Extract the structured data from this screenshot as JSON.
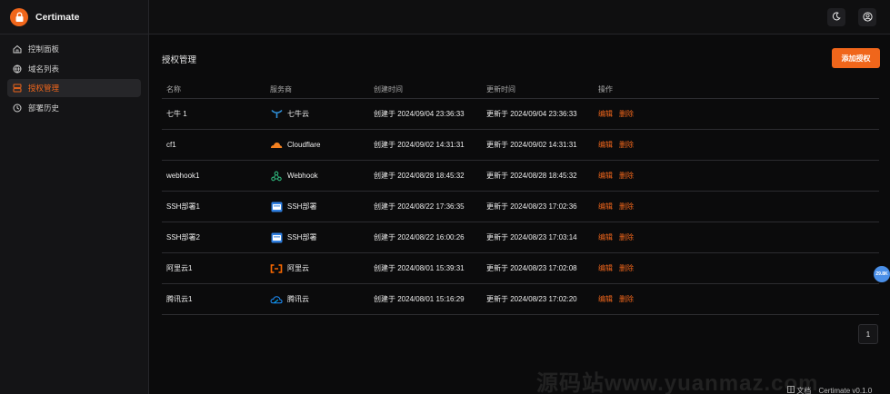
{
  "app": {
    "name": "Certimate"
  },
  "sidebar": {
    "items": [
      {
        "label": "控制面板",
        "icon": "home-icon",
        "active": false
      },
      {
        "label": "域名列表",
        "icon": "globe-icon",
        "active": false
      },
      {
        "label": "授权管理",
        "icon": "server-icon",
        "active": true
      },
      {
        "label": "部署历史",
        "icon": "history-icon",
        "active": false
      }
    ]
  },
  "topbar": {
    "theme_icon": "moon-icon",
    "user_icon": "user-circle-icon"
  },
  "main": {
    "title": "授权管理",
    "add_button": "添加授权",
    "columns": [
      "名称",
      "服务商",
      "创建时间",
      "更新时间",
      "操作"
    ],
    "rows": [
      {
        "name": "七牛 1",
        "provider": "七牛云",
        "provider_icon": "qiniu-icon",
        "created": "创建于 2024/09/04 23:36:33",
        "updated": "更新于 2024/09/04 23:36:33",
        "edit": "编辑",
        "delete": "删除"
      },
      {
        "name": "cf1",
        "provider": "Cloudflare",
        "provider_icon": "cloudflare-icon",
        "created": "创建于 2024/09/02 14:31:31",
        "updated": "更新于 2024/09/02 14:31:31",
        "edit": "编辑",
        "delete": "删除"
      },
      {
        "name": "webhook1",
        "provider": "Webhook",
        "provider_icon": "webhook-icon",
        "created": "创建于 2024/08/28 18:45:32",
        "updated": "更新于 2024/08/28 18:45:32",
        "edit": "编辑",
        "delete": "删除"
      },
      {
        "name": "SSH部署1",
        "provider": "SSH部署",
        "provider_icon": "ssh-icon",
        "created": "创建于 2024/08/22 17:36:35",
        "updated": "更新于 2024/08/23 17:02:36",
        "edit": "编辑",
        "delete": "删除"
      },
      {
        "name": "SSH部署2",
        "provider": "SSH部署",
        "provider_icon": "ssh-icon",
        "created": "创建于 2024/08/22 16:00:26",
        "updated": "更新于 2024/08/23 17:03:14",
        "edit": "编辑",
        "delete": "删除"
      },
      {
        "name": "阿里云1",
        "provider": "阿里云",
        "provider_icon": "aliyun-icon",
        "created": "创建于 2024/08/01 15:39:31",
        "updated": "更新于 2024/08/23 17:02:08",
        "edit": "编辑",
        "delete": "删除"
      },
      {
        "name": "腾讯云1",
        "provider": "腾讯云",
        "provider_icon": "tencent-cloud-icon",
        "created": "创建于 2024/08/01 15:16:29",
        "updated": "更新于 2024/08/23 17:02:20",
        "edit": "编辑",
        "delete": "删除"
      }
    ],
    "pagination": {
      "current": "1"
    }
  },
  "floating_badge": "29.8K",
  "footer": {
    "docs": "文档",
    "version": "Certimate v0.1.0"
  },
  "watermark": "源码站www.yuanmaz.com",
  "colors": {
    "accent": "#f0661b",
    "background": "#0b0b0c",
    "sidebar": "#141416",
    "badge": "#4a8fe8"
  }
}
